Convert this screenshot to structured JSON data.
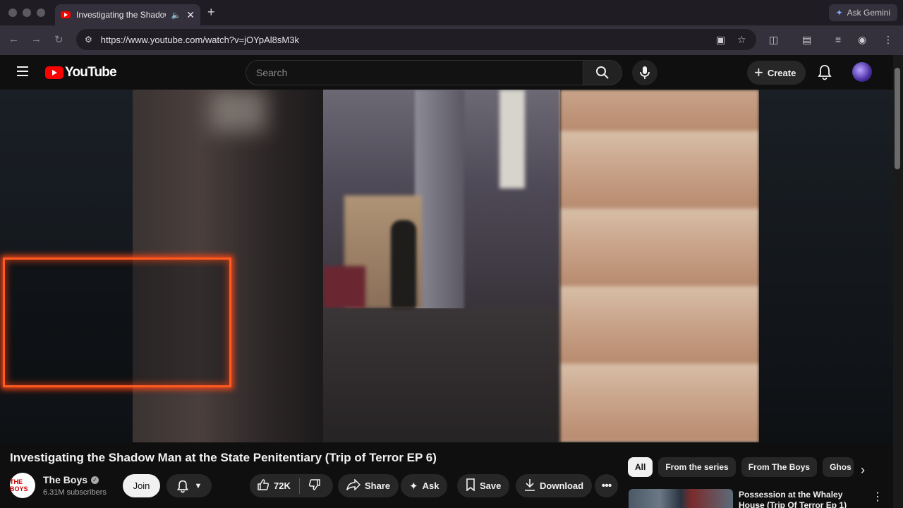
{
  "browser": {
    "tab_title": "Investigating the Shadow",
    "url": "https://www.youtube.com/watch?v=jOYpAl8sM3k",
    "gemini_label": "Ask Gemini"
  },
  "header": {
    "logo_text": "YouTube",
    "search_placeholder": "Search",
    "create_label": "Create"
  },
  "video": {
    "title": "Investigating the Shadow Man at the State Penitentiary (Trip of Terror EP 6)"
  },
  "channel": {
    "avatar_text": "THE BOYS",
    "name": "The Boys",
    "subscribers": "6.31M subscribers",
    "join_label": "Join"
  },
  "actions": {
    "like_count": "72K",
    "share_label": "Share",
    "ask_label": "Ask",
    "save_label": "Save",
    "download_label": "Download"
  },
  "chips": [
    {
      "label": "All",
      "active": true
    },
    {
      "label": "From the series"
    },
    {
      "label": "From The Boys"
    },
    {
      "label": "Ghos"
    }
  ],
  "recommendation": {
    "title": "Possession at the Whaley House (Trip Of Terror Ep 1)"
  },
  "colors": {
    "brand_red": "#ff0000",
    "frame_orange": "#ff5a1f",
    "background": "#0f0f0f"
  }
}
